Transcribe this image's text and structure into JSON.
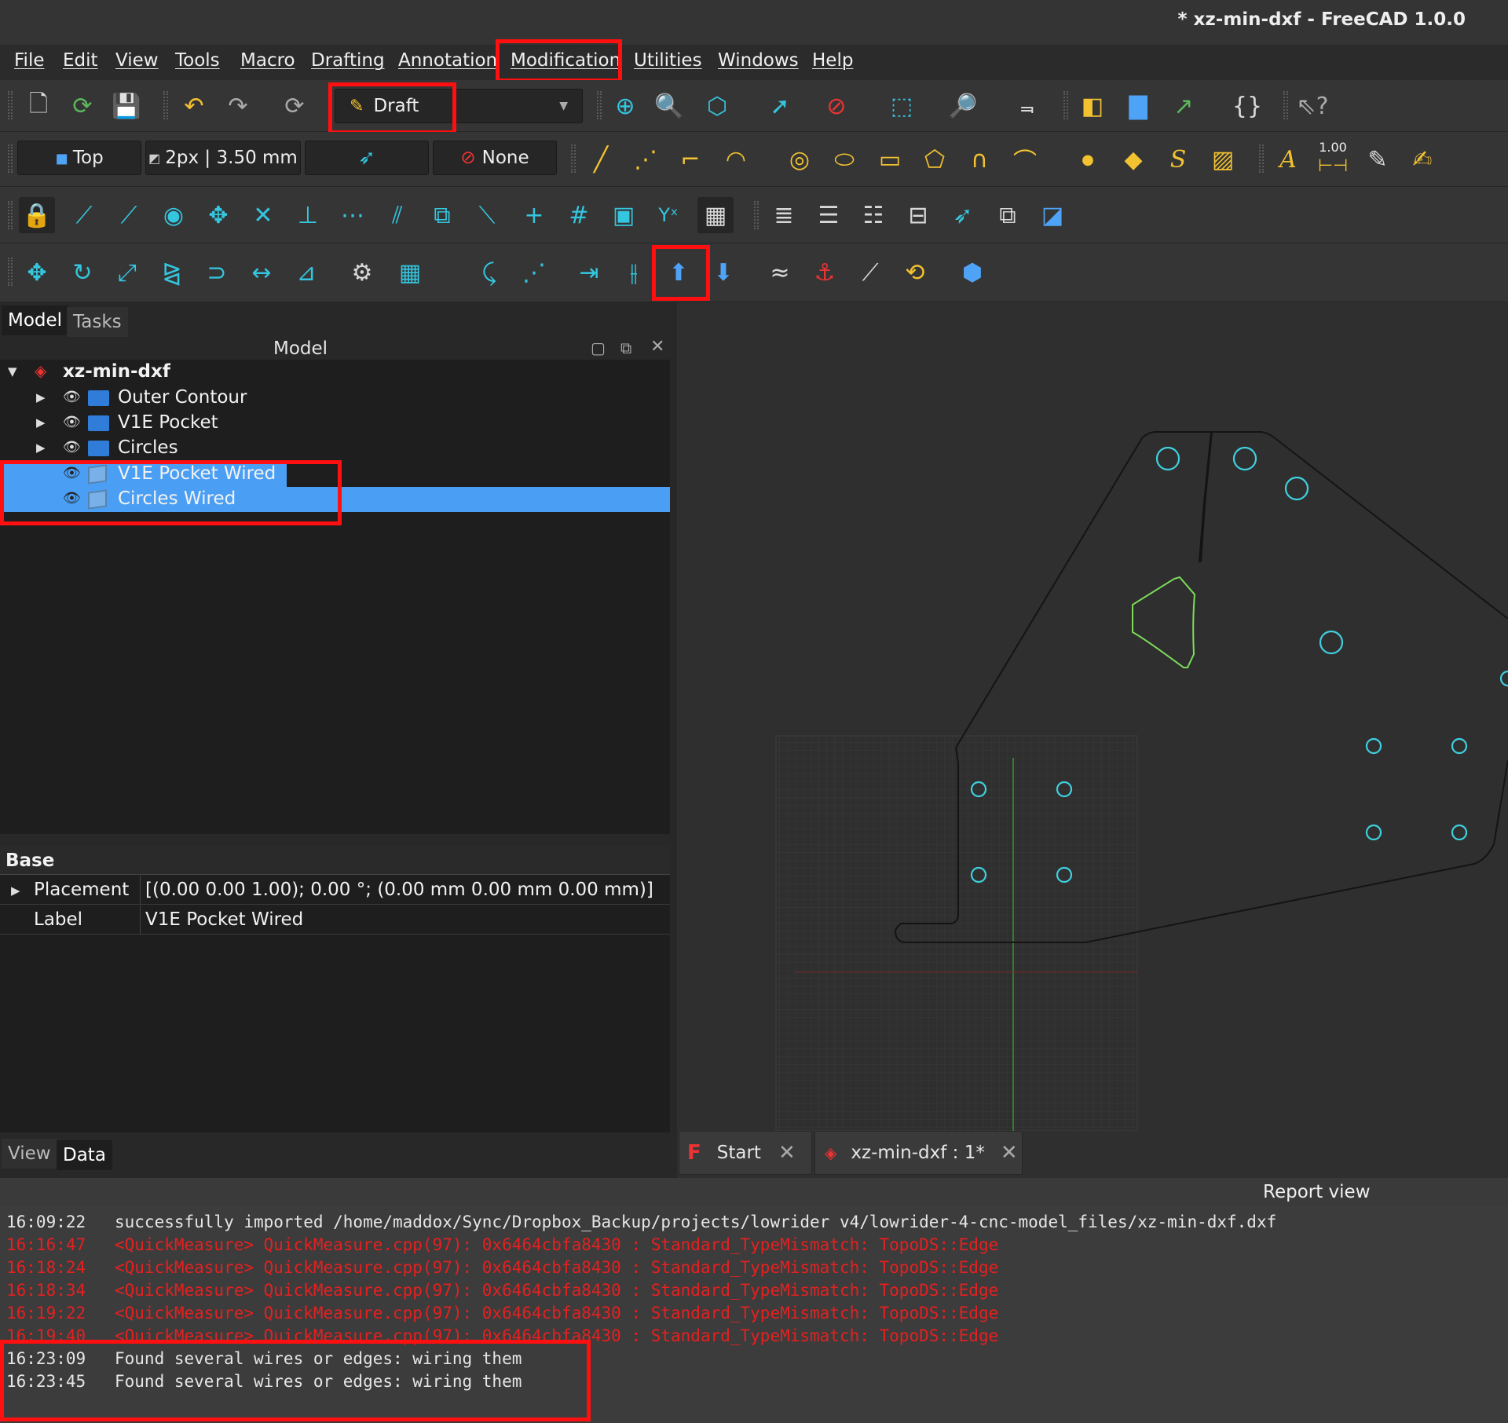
{
  "window": {
    "title": "* xz-min-dxf - FreeCAD 1.0.0"
  },
  "menu": [
    "File",
    "Edit",
    "View",
    "Tools",
    "Macro",
    "Drafting",
    "Annotation",
    "Modification",
    "Utilities",
    "Windows",
    "Help"
  ],
  "toolbar": {
    "workbench": "Draft",
    "view_button": "Top",
    "line_style": "2px | 3.50 mm",
    "snap_none": "None",
    "annotation_a": "A",
    "dim_value": "1.00",
    "text_s": "S"
  },
  "panel": {
    "tabs": [
      "Model",
      "Tasks"
    ],
    "header": "Model",
    "tree": {
      "root": "xz-min-dxf",
      "items": [
        "Outer Contour",
        "V1E Pocket",
        "Circles",
        "V1E Pocket Wired",
        "Circles Wired"
      ]
    },
    "property_group": "Base",
    "properties": [
      {
        "name": "Placement",
        "value": "[(0.00 0.00 1.00); 0.00 °; (0.00 mm  0.00 mm  0.00 mm)]"
      },
      {
        "name": "Label",
        "value": "V1E Pocket Wired"
      }
    ],
    "bottom_tabs": [
      "View",
      "Data"
    ]
  },
  "doc_tabs": [
    {
      "label": "Start"
    },
    {
      "label": "xz-min-dxf : 1*"
    }
  ],
  "report": {
    "title": "Report view",
    "lines": [
      {
        "time": "16:09:22",
        "text": "successfully imported /home/maddox/Sync/Dropbox_Backup/projects/lowrider v4/lowrider-4-cnc-model_files/xz-min-dxf.dxf"
      },
      {
        "time": "16:16:47",
        "text": "<QuickMeasure> QuickMeasure.cpp(97): 0x6464cbfa8430 : Standard_TypeMismatch: TopoDS::Edge"
      },
      {
        "time": "16:18:24",
        "text": "<QuickMeasure> QuickMeasure.cpp(97): 0x6464cbfa8430 : Standard_TypeMismatch: TopoDS::Edge"
      },
      {
        "time": "16:18:34",
        "text": "<QuickMeasure> QuickMeasure.cpp(97): 0x6464cbfa8430 : Standard_TypeMismatch: TopoDS::Edge"
      },
      {
        "time": "16:19:22",
        "text": "<QuickMeasure> QuickMeasure.cpp(97): 0x6464cbfa8430 : Standard_TypeMismatch: TopoDS::Edge"
      },
      {
        "time": "16:19:40",
        "text": "<QuickMeasure> QuickMeasure.cpp(97): 0x6464cbfa8430 : Standard_TypeMismatch: TopoDS::Edge"
      },
      {
        "time": "16:23:09",
        "text": "Found several wires or edges: wiring them"
      },
      {
        "time": "16:23:45",
        "text": "Found several wires or edges: wiring them"
      }
    ]
  },
  "colors": {
    "accent": "#34c6df",
    "selection": "#4a9ff5",
    "highlight_box": "#ff0f0f",
    "error_text": "#e52020",
    "shape_line": "#141414",
    "circle": "#3fd0e0",
    "selected_shape": "#7cdc5a"
  }
}
